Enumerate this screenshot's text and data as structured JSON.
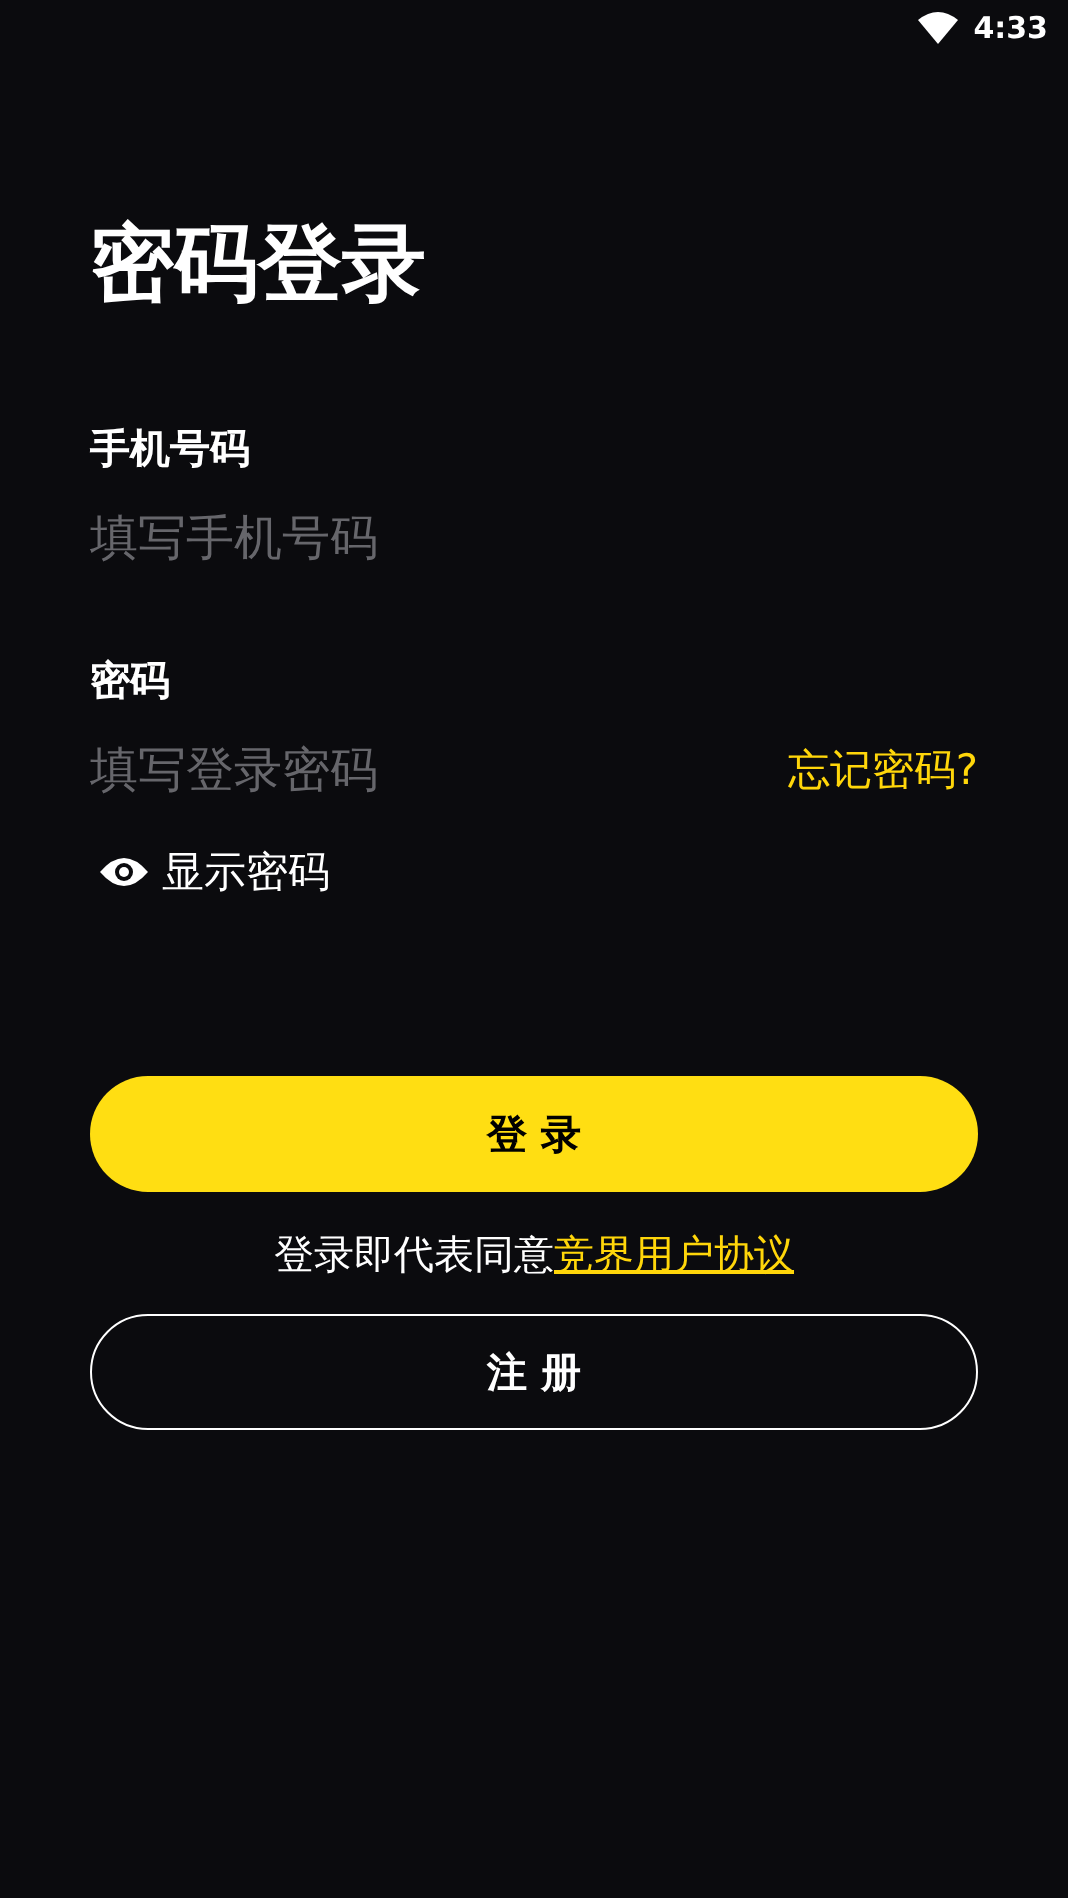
{
  "status_bar": {
    "time": "4:33"
  },
  "title": "密码登录",
  "fields": [
    {
      "label": "手机号码",
      "placeholder": "填写手机号码"
    },
    {
      "label": "密码",
      "placeholder": "填写登录密码",
      "link": "忘记密码?"
    }
  ],
  "show_password": {
    "label": "显示密码"
  },
  "login_button": "登 录",
  "agreement": {
    "text": "登录即代表同意",
    "link": "竞界用户协议"
  },
  "register_button": "注 册"
}
